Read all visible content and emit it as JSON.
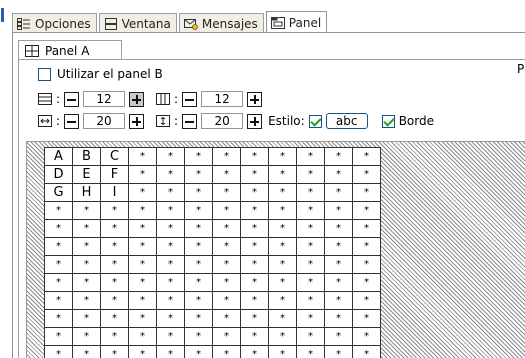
{
  "tabs": [
    {
      "label": "Opciones",
      "icon": "options-icon"
    },
    {
      "label": "Ventana",
      "icon": "window-icon"
    },
    {
      "label": "Mensajes",
      "icon": "messages-icon"
    },
    {
      "label": "Panel",
      "icon": "panel-icon",
      "active": true
    }
  ],
  "panel_tab": {
    "label": "Panel A",
    "icon": "grid-icon"
  },
  "options": {
    "use_panel_b_label": "Utilizar el panel B",
    "use_panel_b_checked": false,
    "right_cutoff_text": "P"
  },
  "rows_cols": {
    "rows_value": "12",
    "cols_value": "12"
  },
  "size_style": {
    "width_value": "20",
    "height_value": "20",
    "style_label": "Estilo:",
    "style_field": "abc",
    "style_checked": true,
    "border_label": "Borde",
    "border_checked": true
  },
  "separator": ":",
  "grid": [
    [
      "A",
      "B",
      "C",
      "*",
      "*",
      "*",
      "*",
      "*",
      "*",
      "*",
      "*",
      "*"
    ],
    [
      "D",
      "E",
      "F",
      "*",
      "*",
      "*",
      "*",
      "*",
      "*",
      "*",
      "*",
      "*"
    ],
    [
      "G",
      "H",
      "I",
      "*",
      "*",
      "*",
      "*",
      "*",
      "*",
      "*",
      "*",
      "*"
    ],
    [
      "*",
      "*",
      "*",
      "*",
      "*",
      "*",
      "*",
      "*",
      "*",
      "*",
      "*",
      "*"
    ],
    [
      "*",
      "*",
      "*",
      "*",
      "*",
      "*",
      "*",
      "*",
      "*",
      "*",
      "*",
      "*"
    ],
    [
      "*",
      "*",
      "*",
      "*",
      "*",
      "*",
      "*",
      "*",
      "*",
      "*",
      "*",
      "*"
    ],
    [
      "*",
      "*",
      "*",
      "*",
      "*",
      "*",
      "*",
      "*",
      "*",
      "*",
      "*",
      "*"
    ],
    [
      "*",
      "*",
      "*",
      "*",
      "*",
      "*",
      "*",
      "*",
      "*",
      "*",
      "*",
      "*"
    ],
    [
      "*",
      "*",
      "*",
      "*",
      "*",
      "*",
      "*",
      "*",
      "*",
      "*",
      "*",
      "*"
    ],
    [
      "*",
      "*",
      "*",
      "*",
      "*",
      "*",
      "*",
      "*",
      "*",
      "*",
      "*",
      "*"
    ],
    [
      "*",
      "*",
      "*",
      "*",
      "*",
      "*",
      "*",
      "*",
      "*",
      "*",
      "*",
      "*"
    ],
    [
      "*",
      "*",
      "*",
      "*",
      "*",
      "*",
      "*",
      "*",
      "*",
      "*",
      "*",
      "*"
    ]
  ],
  "colors": {
    "tab_bg": "#f1efe4",
    "check_green": "#21a121",
    "check_border": "#1c5180"
  }
}
